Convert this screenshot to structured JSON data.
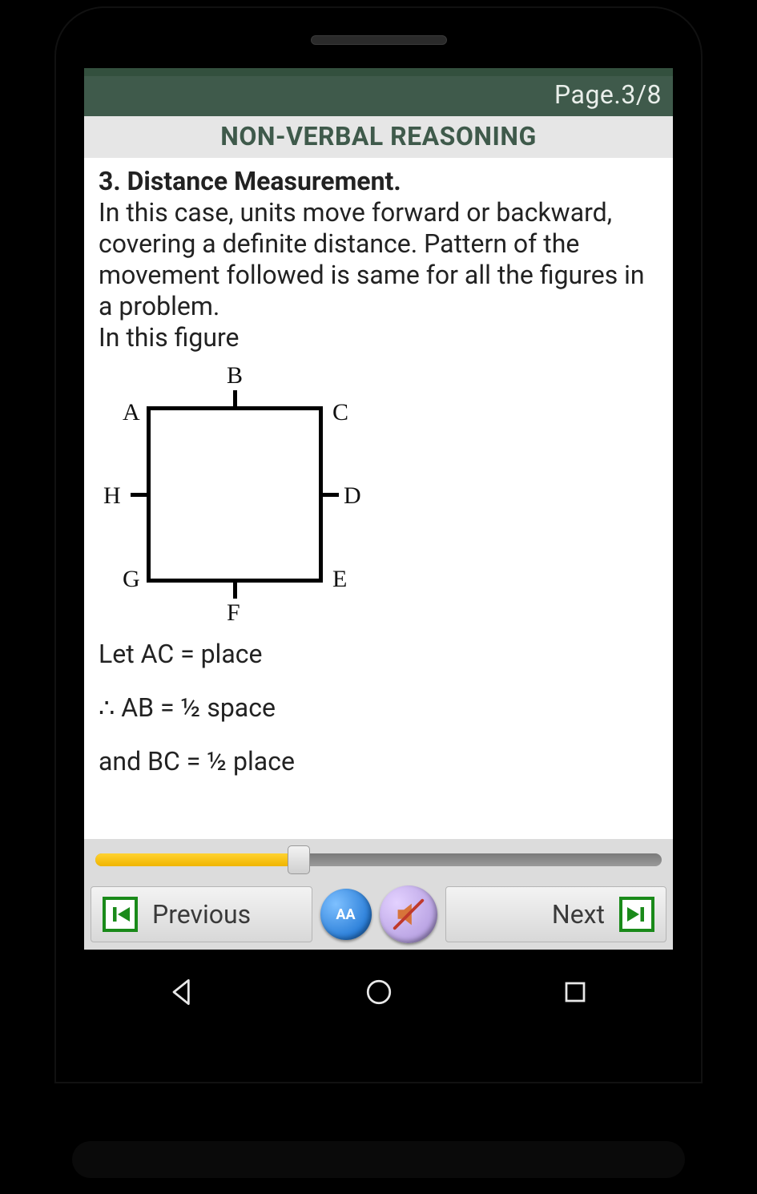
{
  "page_indicator": "Page.3/8",
  "title": "NON-VERBAL REASONING",
  "content": {
    "heading": "3. Distance Measurement.",
    "paragraph": "In this case, units move forward or backward, covering a definite distance. Pattern of the movement followed is same for all the figures in a problem.",
    "lead_in": "In this figure",
    "figure_labels": {
      "A": "A",
      "B": "B",
      "C": "C",
      "D": "D",
      "E": "E",
      "F": "F",
      "G": "G",
      "H": "H"
    },
    "lines": [
      "Let AC = place",
      "∴ AB = ½ space",
      "and BC = ½ place"
    ]
  },
  "slider": {
    "percent": 36
  },
  "buttons": {
    "previous": "Previous",
    "next": "Next",
    "font_size": "AA"
  }
}
